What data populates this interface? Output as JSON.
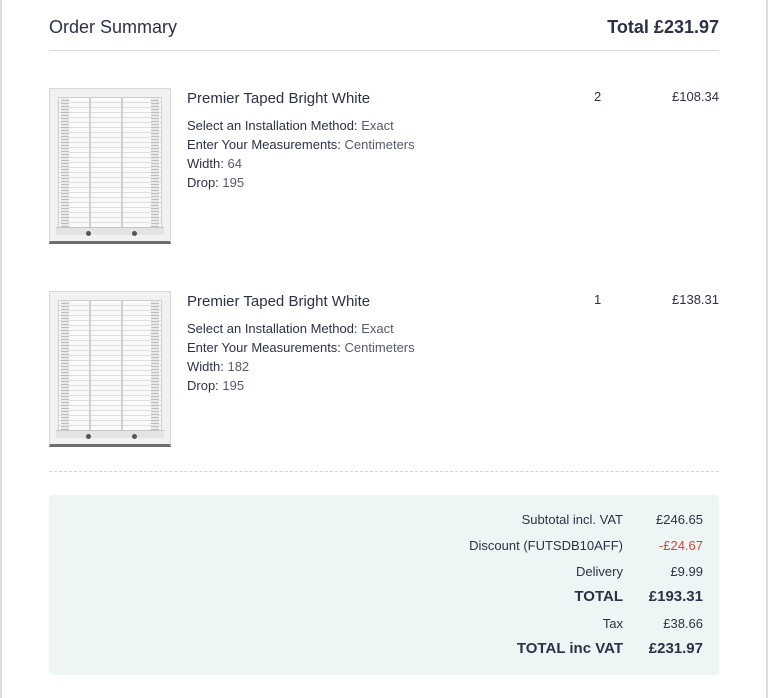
{
  "header": {
    "title": "Order Summary",
    "total": "Total £231.97"
  },
  "items": [
    {
      "name": "Premier Taped Bright White",
      "qty": "2",
      "price": "£108.34",
      "options": [
        {
          "label": "Select an Installation Method:",
          "value": "Exact"
        },
        {
          "label": "Enter Your Measurements:",
          "value": "Centimeters"
        },
        {
          "label": "Width:",
          "value": "64"
        },
        {
          "label": "Drop:",
          "value": "195"
        }
      ]
    },
    {
      "name": "Premier Taped Bright White",
      "qty": "1",
      "price": "£138.31",
      "options": [
        {
          "label": "Select an Installation Method:",
          "value": "Exact"
        },
        {
          "label": "Enter Your Measurements:",
          "value": "Centimeters"
        },
        {
          "label": "Width:",
          "value": "182"
        },
        {
          "label": "Drop:",
          "value": "195"
        }
      ]
    }
  ],
  "totals": {
    "subtotal": {
      "label": "Subtotal incl. VAT",
      "value": "£246.65"
    },
    "discount": {
      "label": "Discount (FUTSDB10AFF)",
      "value": "-£24.67"
    },
    "delivery": {
      "label": "Delivery",
      "value": "£9.99"
    },
    "total": {
      "label": "TOTAL",
      "value": "£193.31"
    },
    "tax": {
      "label": "Tax",
      "value": "£38.66"
    },
    "total_inc_vat": {
      "label": "TOTAL inc VAT",
      "value": "£231.97"
    }
  },
  "colors": {
    "text": "#2b3245",
    "discount": "#d0453a",
    "totals_background": "#eef6f5"
  }
}
